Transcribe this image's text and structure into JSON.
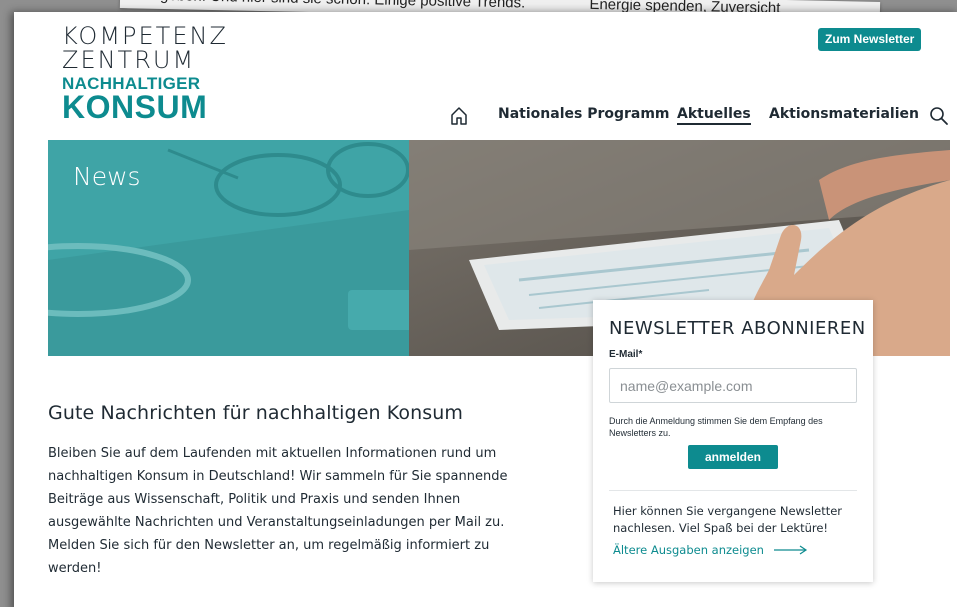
{
  "background_snippet": {
    "line_left": "geben. Und hier sind sie schon: Einige positive Trends.",
    "line_right": "Energie spenden, Zuversicht"
  },
  "logo": {
    "line1": "KOMPETENZ",
    "line2": "ZENTRUM",
    "line3": "NACHHALTIGER",
    "line4": "KONSUM"
  },
  "header": {
    "newsletter_button": "Zum Newsletter"
  },
  "nav": {
    "items": [
      {
        "label": "Nationales Programm",
        "active": false
      },
      {
        "label": "Aktuelles",
        "active": true
      },
      {
        "label": "Aktionsmaterialien",
        "active": false
      }
    ],
    "home_icon": "home-icon",
    "search_icon": "search-icon"
  },
  "hero": {
    "title": "News"
  },
  "newsletter": {
    "title": "NEWSLETTER ABONNIEREN",
    "email_label": "E-Mail*",
    "email_placeholder": "name@example.com",
    "email_value": "",
    "consent": "Durch die Anmeldung stimmen Sie dem Empfang des Newsletters zu.",
    "submit": "anmelden",
    "archive_text": "Hier können Sie vergangene Newsletter nachlesen. Viel Spaß bei der Lektüre!",
    "archive_link": "Ältere Ausgaben anzeigen"
  },
  "main": {
    "heading": "Gute Nachrichten für nachhaltigen Konsum",
    "body": "Bleiben Sie auf dem Laufenden mit aktuellen Informationen rund um nachhaltigen Konsum in Deutschland! Wir sammeln für Sie spannende Beiträge aus Wissenschaft, Politik und Praxis und senden Ihnen ausgewählte Nachrichten und Veranstaltungseinladungen per Mail zu. Melden Sie sich für den Newsletter an, um regelmäßig informiert zu werden!"
  },
  "colors": {
    "accent": "#0d8b8f",
    "hero_teal": "#3fa4a6",
    "text": "#1f2a33"
  }
}
